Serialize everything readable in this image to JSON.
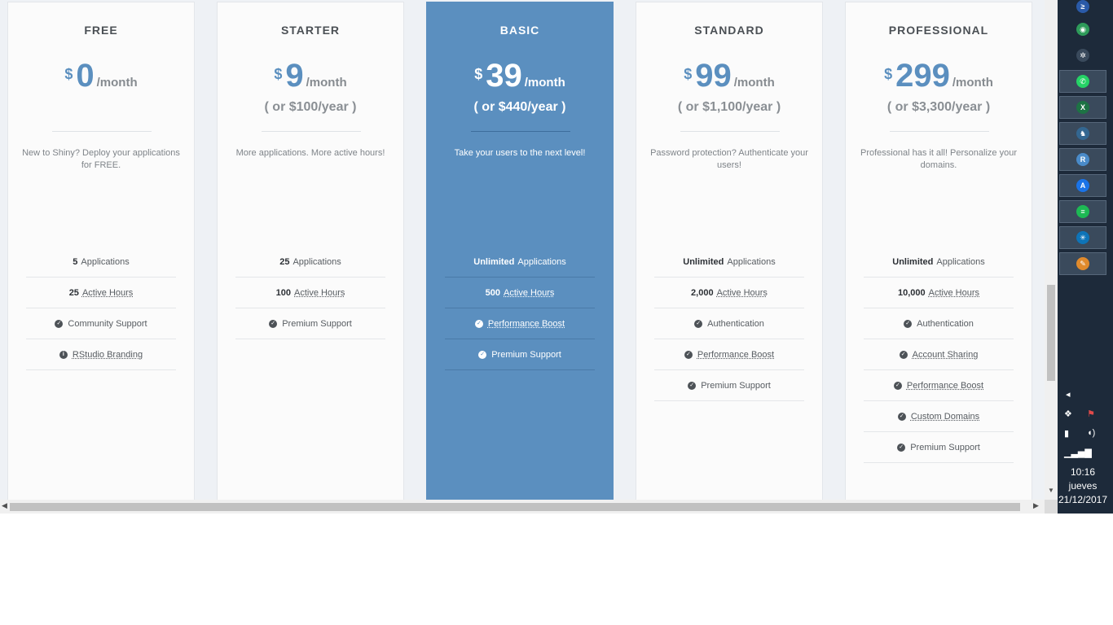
{
  "plans": [
    {
      "name": "FREE",
      "currency": "$",
      "amount": "0",
      "period": "/month",
      "yearly": "",
      "description": "New to Shiny? Deploy your applications for FREE.",
      "features": [
        {
          "bold": "5",
          "text": "Applications",
          "icon": "",
          "underline": false
        },
        {
          "bold": "25",
          "text": "Active Hours",
          "icon": "",
          "underline": true
        },
        {
          "bold": "",
          "text": "Community Support",
          "icon": "check-circle-icon",
          "underline": false
        },
        {
          "bold": "",
          "text": "RStudio Branding",
          "icon": "info-circle-icon",
          "underline": true
        }
      ]
    },
    {
      "name": "STARTER",
      "currency": "$",
      "amount": "9",
      "period": "/month",
      "yearly": "( or $100/year )",
      "description": "More applications. More active hours!",
      "features": [
        {
          "bold": "25",
          "text": "Applications",
          "icon": "",
          "underline": false
        },
        {
          "bold": "100",
          "text": "Active Hours",
          "icon": "",
          "underline": true
        },
        {
          "bold": "",
          "text": "Premium Support",
          "icon": "check-circle-icon",
          "underline": false
        }
      ]
    },
    {
      "name": "BASIC",
      "currency": "$",
      "amount": "39",
      "period": "/month",
      "yearly": "( or $440/year )",
      "description": "Take your users to the next level!",
      "features": [
        {
          "bold": "Unlimited",
          "text": "Applications",
          "icon": "",
          "underline": false
        },
        {
          "bold": "500",
          "text": "Active Hours",
          "icon": "",
          "underline": true
        },
        {
          "bold": "",
          "text": "Performance Boost",
          "icon": "check-circle-icon",
          "underline": true
        },
        {
          "bold": "",
          "text": "Premium Support",
          "icon": "check-circle-icon",
          "underline": false
        }
      ]
    },
    {
      "name": "STANDARD",
      "currency": "$",
      "amount": "99",
      "period": "/month",
      "yearly": "( or $1,100/year )",
      "description": "Password protection? Authenticate your users!",
      "features": [
        {
          "bold": "Unlimited",
          "text": "Applications",
          "icon": "",
          "underline": false
        },
        {
          "bold": "2,000",
          "text": "Active Hours",
          "icon": "",
          "underline": true
        },
        {
          "bold": "",
          "text": "Authentication",
          "icon": "check-circle-icon",
          "underline": false
        },
        {
          "bold": "",
          "text": "Performance Boost",
          "icon": "check-circle-icon",
          "underline": true
        },
        {
          "bold": "",
          "text": "Premium Support",
          "icon": "check-circle-icon",
          "underline": false
        }
      ]
    },
    {
      "name": "PROFESSIONAL",
      "currency": "$",
      "amount": "299",
      "period": "/month",
      "yearly": "( or $3,300/year )",
      "description": "Professional has it all! Personalize your domains.",
      "features": [
        {
          "bold": "Unlimited",
          "text": "Applications",
          "icon": "",
          "underline": false
        },
        {
          "bold": "10,000",
          "text": "Active Hours",
          "icon": "",
          "underline": true
        },
        {
          "bold": "",
          "text": "Authentication",
          "icon": "check-circle-icon",
          "underline": false
        },
        {
          "bold": "",
          "text": "Account Sharing",
          "icon": "check-circle-icon",
          "underline": true
        },
        {
          "bold": "",
          "text": "Performance Boost",
          "icon": "check-circle-icon",
          "underline": true
        },
        {
          "bold": "",
          "text": "Custom Domains",
          "icon": "check-circle-icon",
          "underline": true
        },
        {
          "bold": "",
          "text": "Premium Support",
          "icon": "check-circle-icon",
          "underline": false
        }
      ]
    }
  ],
  "featured_plan": "BASIC",
  "colors": {
    "accent": "#5b8fbf",
    "taskbar": "#1d2a3a"
  },
  "taskbar": {
    "apps": [
      {
        "name": "powershell-icon",
        "glyph": "≥",
        "color": "#2a5aa8",
        "active": false
      },
      {
        "name": "chrome-like-icon",
        "glyph": "◉",
        "color": "#2e9b5a",
        "active": false
      },
      {
        "name": "settings-wheel-icon",
        "glyph": "✲",
        "color": "#3a4a5c",
        "active": false
      },
      {
        "name": "whatsapp-icon",
        "glyph": "✆",
        "color": "#25d366",
        "active": true
      },
      {
        "name": "excel-icon",
        "glyph": "X",
        "color": "#1d7344",
        "active": true
      },
      {
        "name": "postgres-icon",
        "glyph": "♞",
        "color": "#336791",
        "active": true
      },
      {
        "name": "rstudio-icon",
        "glyph": "R",
        "color": "#4a8bc9",
        "active": true
      },
      {
        "name": "app-a-icon",
        "glyph": "A",
        "color": "#1a73e8",
        "active": true
      },
      {
        "name": "spotify-icon",
        "glyph": "≡",
        "color": "#1db954",
        "active": true
      },
      {
        "name": "network-app-icon",
        "glyph": "✳",
        "color": "#0e74b8",
        "active": true
      },
      {
        "name": "paint-icon",
        "glyph": "✎",
        "color": "#e08a2c",
        "active": true
      }
    ],
    "clock": {
      "time": "10:16",
      "day": "jueves",
      "date": "21/12/2017"
    }
  }
}
